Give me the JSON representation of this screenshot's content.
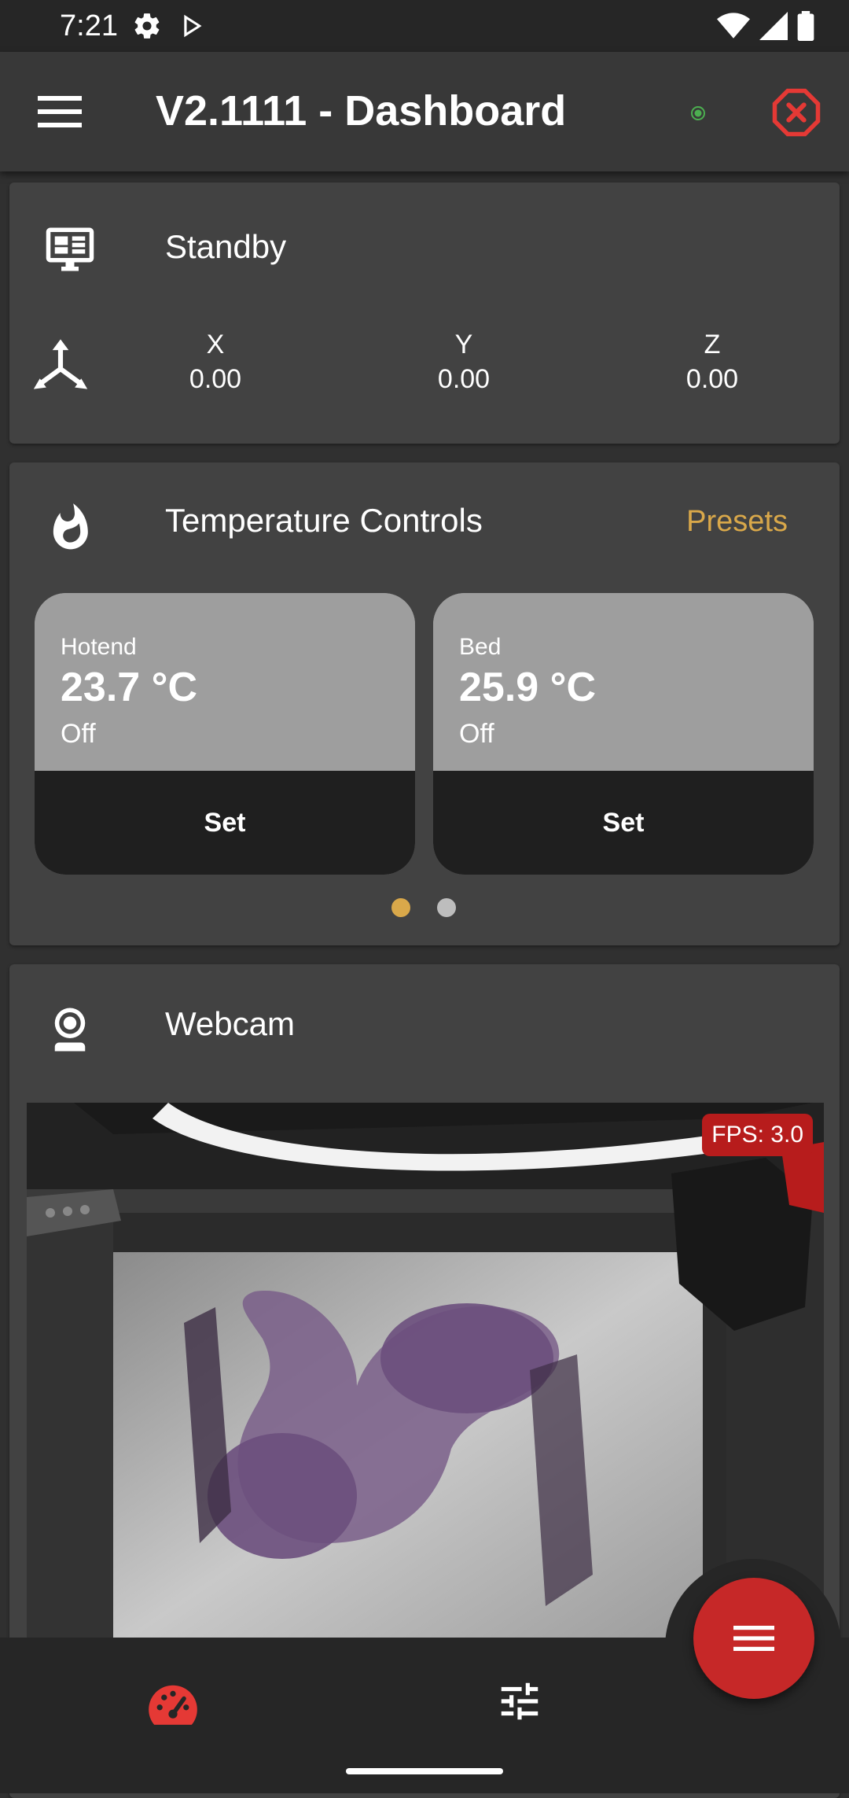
{
  "status_bar": {
    "time": "7:21"
  },
  "app_bar": {
    "title": "V2.1111 - Dashboard"
  },
  "status_card": {
    "title": "Standby",
    "axes": [
      {
        "label": "X",
        "value": "0.00"
      },
      {
        "label": "Y",
        "value": "0.00"
      },
      {
        "label": "Z",
        "value": "0.00"
      }
    ]
  },
  "temperature_card": {
    "title": "Temperature Controls",
    "presets_label": "Presets",
    "tiles": [
      {
        "label": "Hotend",
        "value": "23.7 °C",
        "state": "Off",
        "button": "Set"
      },
      {
        "label": "Bed",
        "value": "25.9 °C",
        "state": "Off",
        "button": "Set"
      }
    ],
    "page_count": 2,
    "active_page": 1
  },
  "webcam_card": {
    "title": "Webcam",
    "fps_label": "FPS: 3.0"
  },
  "colors": {
    "accent": "#d9a84a",
    "danger": "#c62828",
    "connected": "#4caf50",
    "card": "#424242",
    "background": "#303030"
  }
}
